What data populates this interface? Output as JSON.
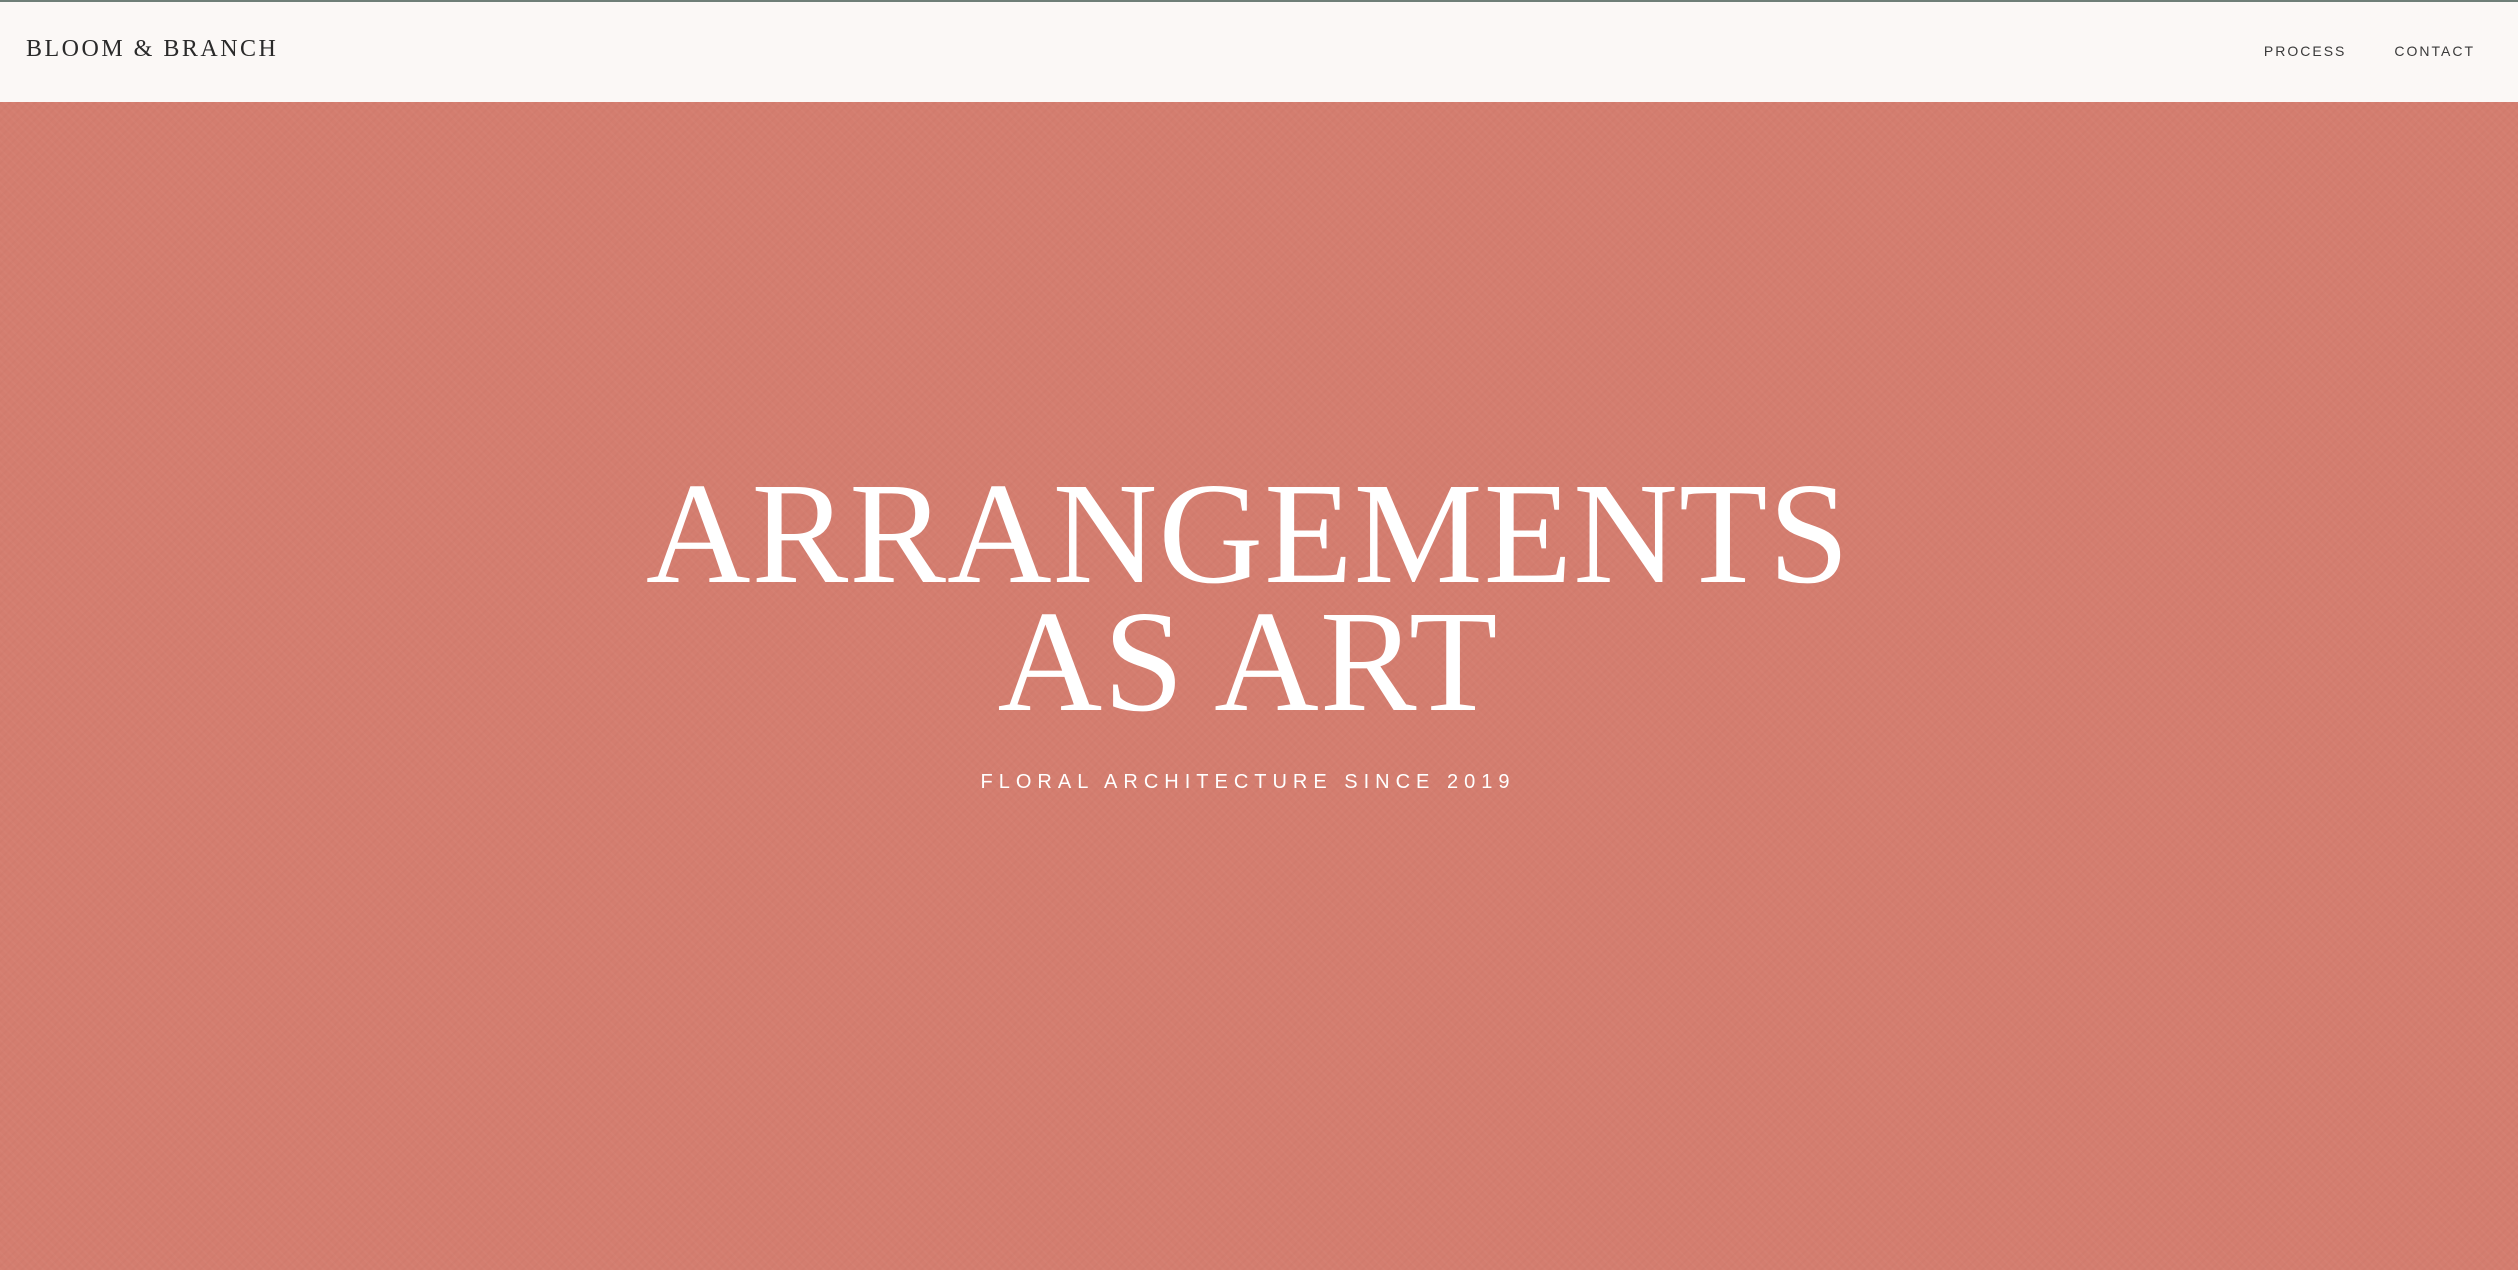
{
  "header": {
    "brand": "BLOOM & BRANCH",
    "nav": [
      {
        "label": "PROCESS"
      },
      {
        "label": "CONTACT"
      }
    ]
  },
  "hero": {
    "headline_line1": "ARRANGEMENTS",
    "headline_line2": "AS ART",
    "tagline": "FLORAL ARCHITECTURE SINCE 2019"
  },
  "colors": {
    "header_bg": "#fbf8f6",
    "hero_bg": "#d47d6f",
    "brand_text": "#2a2a2a",
    "hero_text": "#ffffff"
  }
}
